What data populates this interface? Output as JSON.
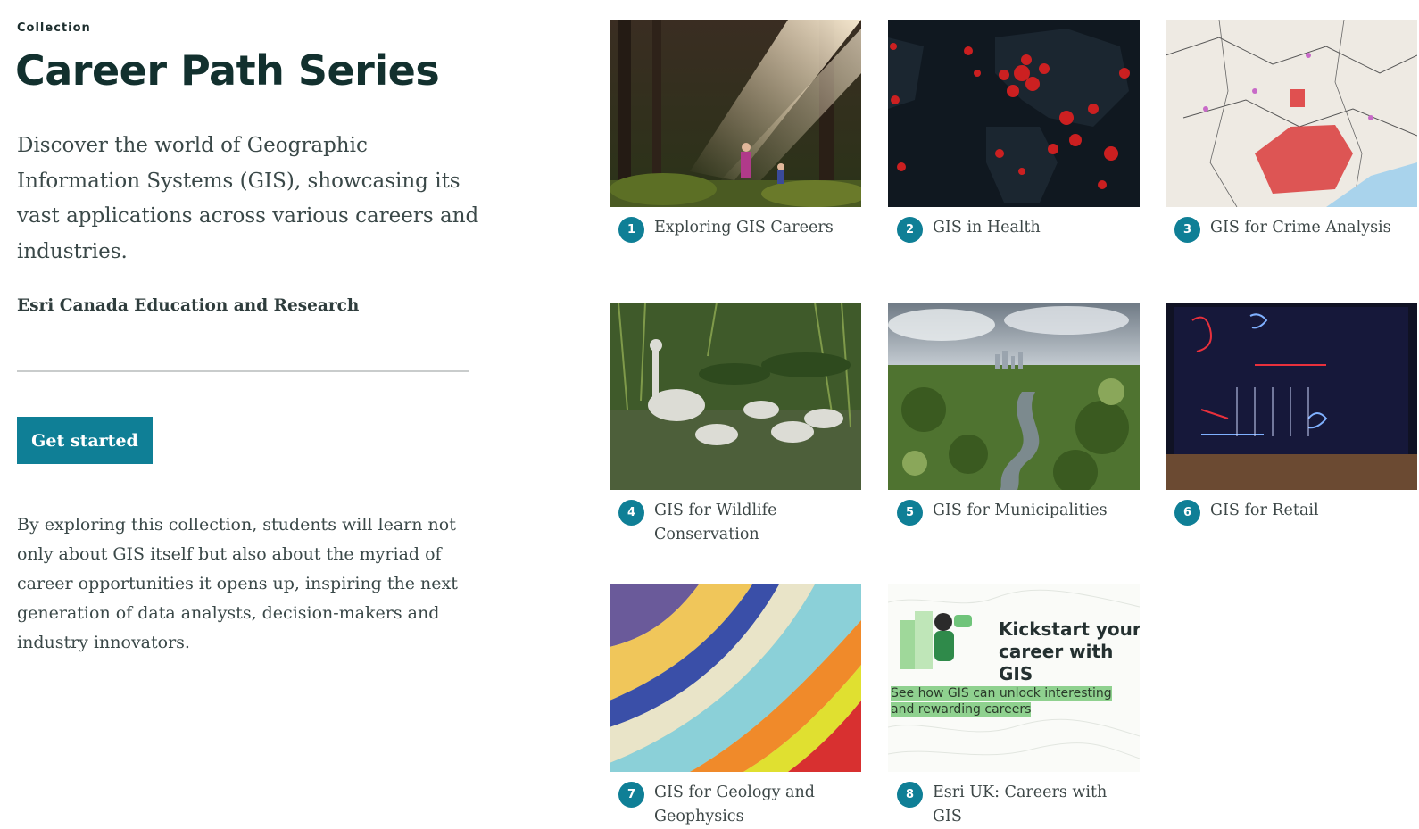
{
  "header": {
    "eyebrow": "Collection",
    "title": "Career Path Series"
  },
  "intro": {
    "description": "Discover the world of Geographic Information Systems (GIS), showcasing its vast applications across various careers and industries.",
    "author": "Esri Canada Education and Research",
    "cta_label": "Get started",
    "body": "By exploring this collection, students will learn not only about GIS itself but also about the myriad of career opportunities it opens up, inspiring the next generation of data analysts, decision-makers and industry innovators."
  },
  "items": [
    {
      "num": "1",
      "title": "Exploring GIS Careers",
      "image": "forest-sunbeams-photo"
    },
    {
      "num": "2",
      "title": "GIS in Health",
      "image": "world-dark-map-red-dots"
    },
    {
      "num": "3",
      "title": "GIS for Crime Analysis",
      "image": "city-hex-map"
    },
    {
      "num": "4",
      "title": "GIS for Wildlife Conservation",
      "image": "swans-photo"
    },
    {
      "num": "5",
      "title": "GIS for Municipalities",
      "image": "city-river-aerial-photo"
    },
    {
      "num": "6",
      "title": "GIS for Retail",
      "image": "neon-sale-signs-photo"
    },
    {
      "num": "7",
      "title": "GIS for Geology and Geophysics",
      "image": "colorful-terrain-relief"
    },
    {
      "num": "8",
      "title": "Esri UK: Careers with GIS",
      "image": "kickstart-promo-graphic"
    }
  ],
  "promo": {
    "title_line1": "Kickstart your",
    "title_line2": "career with GIS",
    "sub_line1": "See how GIS can unlock interesting",
    "sub_line2": "and rewarding careers"
  },
  "colors": {
    "accent": "#0f7f96",
    "title": "#12302e"
  }
}
